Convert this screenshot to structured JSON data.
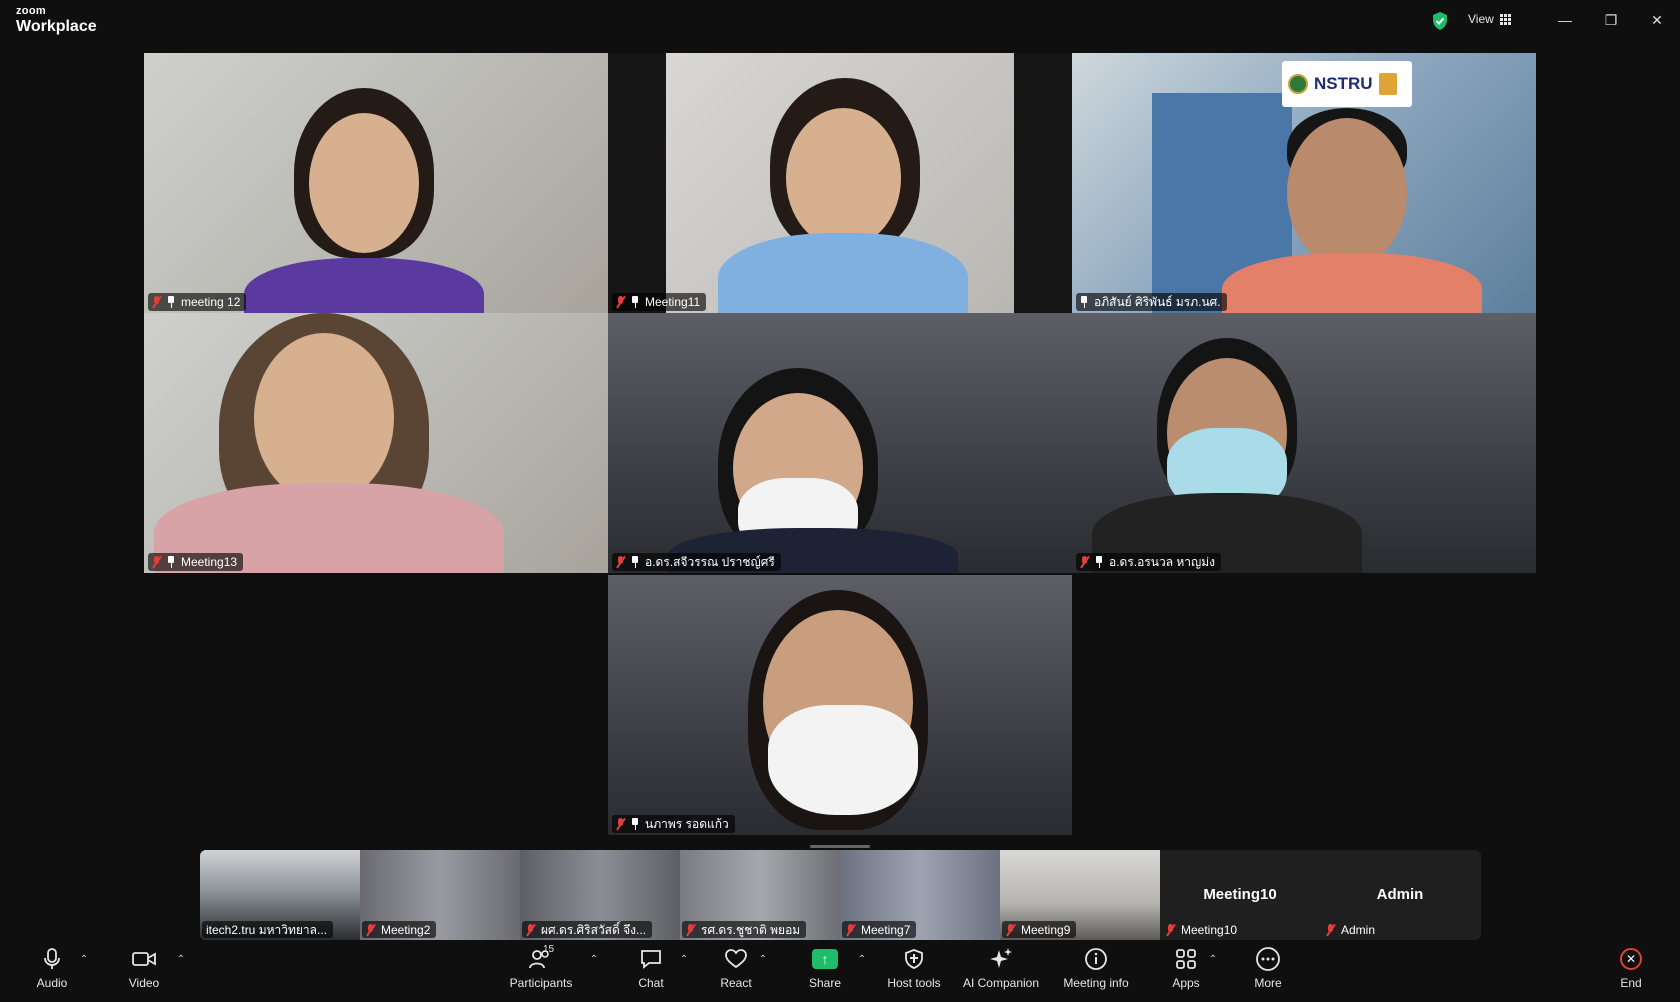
{
  "app": {
    "brand": "zoom",
    "product": "Workplace",
    "view_label": "View",
    "colors": {
      "accent_green": "#1ebc6b",
      "mute_red": "#e0403a",
      "background": "#0f0f0f"
    }
  },
  "tiles": [
    {
      "name": "meeting 12"
    },
    {
      "name": "Meeting11"
    },
    {
      "name": "อภิสันย์ ศิริพันธ์ มรภ.นศ.",
      "logo_text": "NSTRU"
    },
    {
      "name": "Meeting13"
    },
    {
      "name": "อ.ดร.สจีวรรณ ปราชญ์ศรี"
    },
    {
      "name": "อ.ดร.อรนวล หาญม่ง"
    },
    {
      "name": "นภาพร รอดแก้ว"
    }
  ],
  "thumbnails": [
    {
      "label": "itech2.tru มหาวิทยาล..."
    },
    {
      "label": "Meeting2"
    },
    {
      "label": "ผศ.ดร.ศิริสวัสดิ์ จึง..."
    },
    {
      "label": "รศ.ดร.ชูชาติ พยอม"
    },
    {
      "label": "Meeting7"
    },
    {
      "label": "Meeting9"
    },
    {
      "label": "Meeting10",
      "center": "Meeting10"
    },
    {
      "label": "Admin",
      "center": "Admin"
    }
  ],
  "toolbar": {
    "audio": "Audio",
    "video": "Video",
    "participants": "Participants",
    "participants_count": "15",
    "chat": "Chat",
    "react": "React",
    "share": "Share",
    "host_tools": "Host tools",
    "ai_companion": "AI Companion",
    "meeting_info": "Meeting info",
    "apps": "Apps",
    "more": "More",
    "end": "End"
  }
}
